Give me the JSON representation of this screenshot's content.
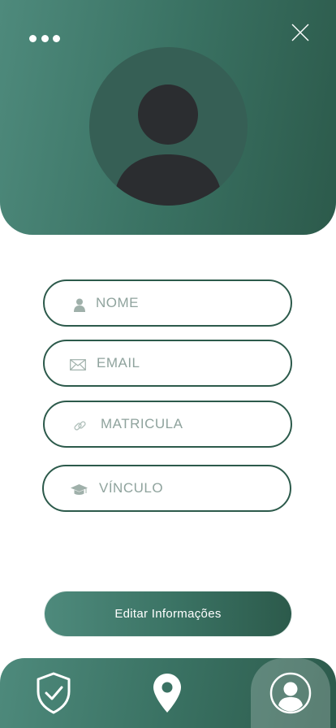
{
  "header": {
    "more_icon": "more-horizontal-icon",
    "close_icon": "close-icon",
    "avatar_icon": "user-avatar-placeholder"
  },
  "form": {
    "fields": [
      {
        "icon": "user-icon",
        "label": "NOME"
      },
      {
        "icon": "envelope-icon",
        "label": "EMAIL"
      },
      {
        "icon": "link-icon",
        "label": "MATRICULA"
      },
      {
        "icon": "graduation-cap-icon",
        "label": "VÍNCULO"
      }
    ],
    "edit_button_label": "Editar Informações"
  },
  "bottom_nav": {
    "items": [
      {
        "icon": "shield-check-icon",
        "active": false
      },
      {
        "icon": "map-pin-icon",
        "active": false
      },
      {
        "icon": "profile-icon",
        "active": true
      }
    ]
  },
  "colors": {
    "primary_dark": "#2c5a4b",
    "primary": "#3a7263",
    "primary_light": "#4e8a7c",
    "avatar_bg": "#365f55",
    "avatar_figure": "#2b2d30",
    "placeholder_text": "#8fa39d"
  }
}
